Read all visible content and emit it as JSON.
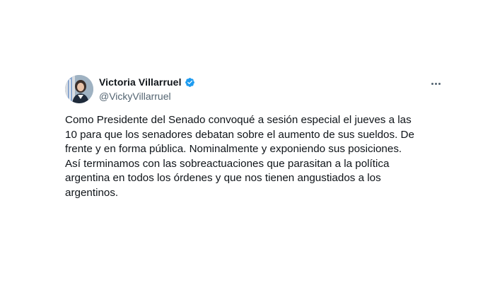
{
  "author": {
    "display_name": "Victoria Villarruel",
    "handle": "@VickyVillarruel",
    "verified": true,
    "avatar_icon": "profile-photo"
  },
  "menu": {
    "more_icon": "more-horizontal-icon"
  },
  "tweet": {
    "text": "Como Presidente del Senado convoqué a sesión especial el jueves a las\n10 para que los senadores debatan sobre el aumento de sus sueldos. De\nfrente y en forma pública. Nominalmente y exponiendo sus posiciones.\nAsí terminamos con las sobreactuaciones que parasitan a la política\nargentina en todos los órdenes y que nos tienen angustiados a los\nargentinos."
  },
  "colors": {
    "verified_badge": "#1d9bf0",
    "text_primary": "#0f1419",
    "text_secondary": "#536471"
  }
}
